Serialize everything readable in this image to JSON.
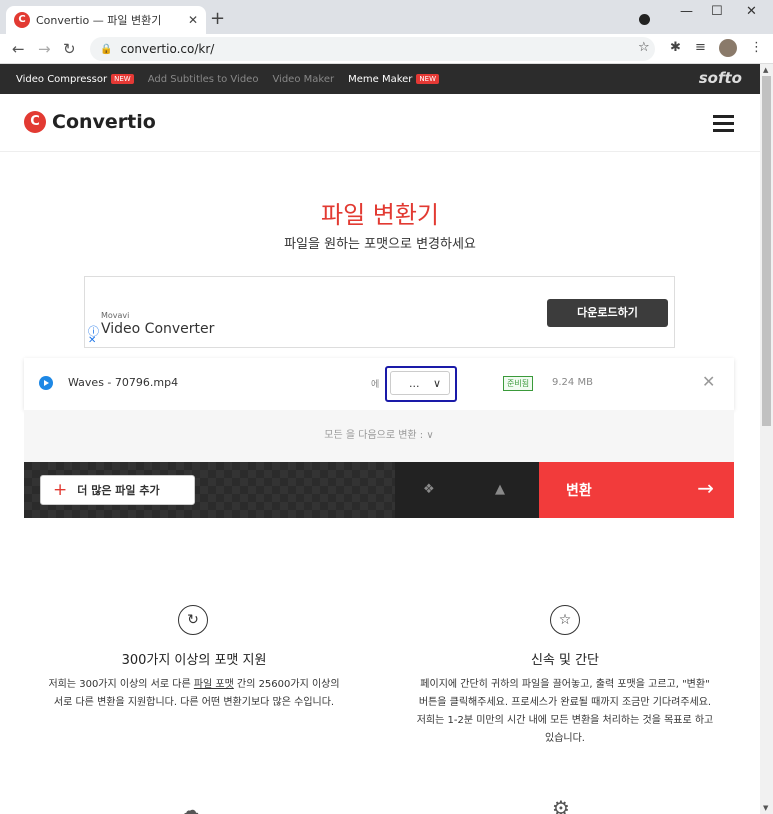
{
  "browser": {
    "tab_title": "Convertio — 파일 변환기",
    "tab_favicon": "C",
    "url": "convertio.co/kr/"
  },
  "topstrip": {
    "links": [
      {
        "label": "Video Compressor",
        "badge": "NEW",
        "bright": true
      },
      {
        "label": "Add Subtitles to Video",
        "badge": "",
        "bright": false
      },
      {
        "label": "Video Maker",
        "badge": "",
        "bright": false
      },
      {
        "label": "Meme Maker",
        "badge": "NEW",
        "bright": true
      }
    ],
    "brand": "softo"
  },
  "header": {
    "logo_text": "Convertio"
  },
  "hero": {
    "title": "파일 변환기",
    "subtitle": "파일을 원하는 포맷으로 변경하세요"
  },
  "ad": {
    "brand": "Movavi",
    "product": "Video Converter",
    "button": "다운로드하기"
  },
  "file": {
    "name": "Waves - 70796.mp4",
    "to_label": "에",
    "format_value": "...",
    "status": "준비됨",
    "size": "9.24 MB"
  },
  "convert_all": "모든 을 다음으로 변환 : ∨",
  "actions": {
    "add_files": "더 많은 파일 추가",
    "convert": "변환"
  },
  "features": [
    {
      "icon": "refresh-icon",
      "title": "300가지 이상의 포맷 지원",
      "desc_parts": [
        "저희는 300가지 이상의 서로 다른 ",
        "파일 포맷",
        " 간의 25600가지 이상의 서로 다른 변환을 지원합니다. 다른 어떤 변환기보다 많은 수입니다."
      ]
    },
    {
      "icon": "star-icon",
      "title": "신속 및 간단",
      "desc": "페이지에 간단히 귀하의 파일을 끌어놓고, 출력 포맷을 고르고, \"변환\" 버튼을 클릭해주세요. 프로세스가 완료될 때까지 조금만 기다려주세요. 저희는 1-2분 미만의 시간 내에 모든 변환을 처리하는 것을 목표로 하고 있습니다."
    }
  ],
  "colors": {
    "brand": "#e23a32",
    "convert": "#f23b3b",
    "annotation": "#1a1aa8"
  }
}
